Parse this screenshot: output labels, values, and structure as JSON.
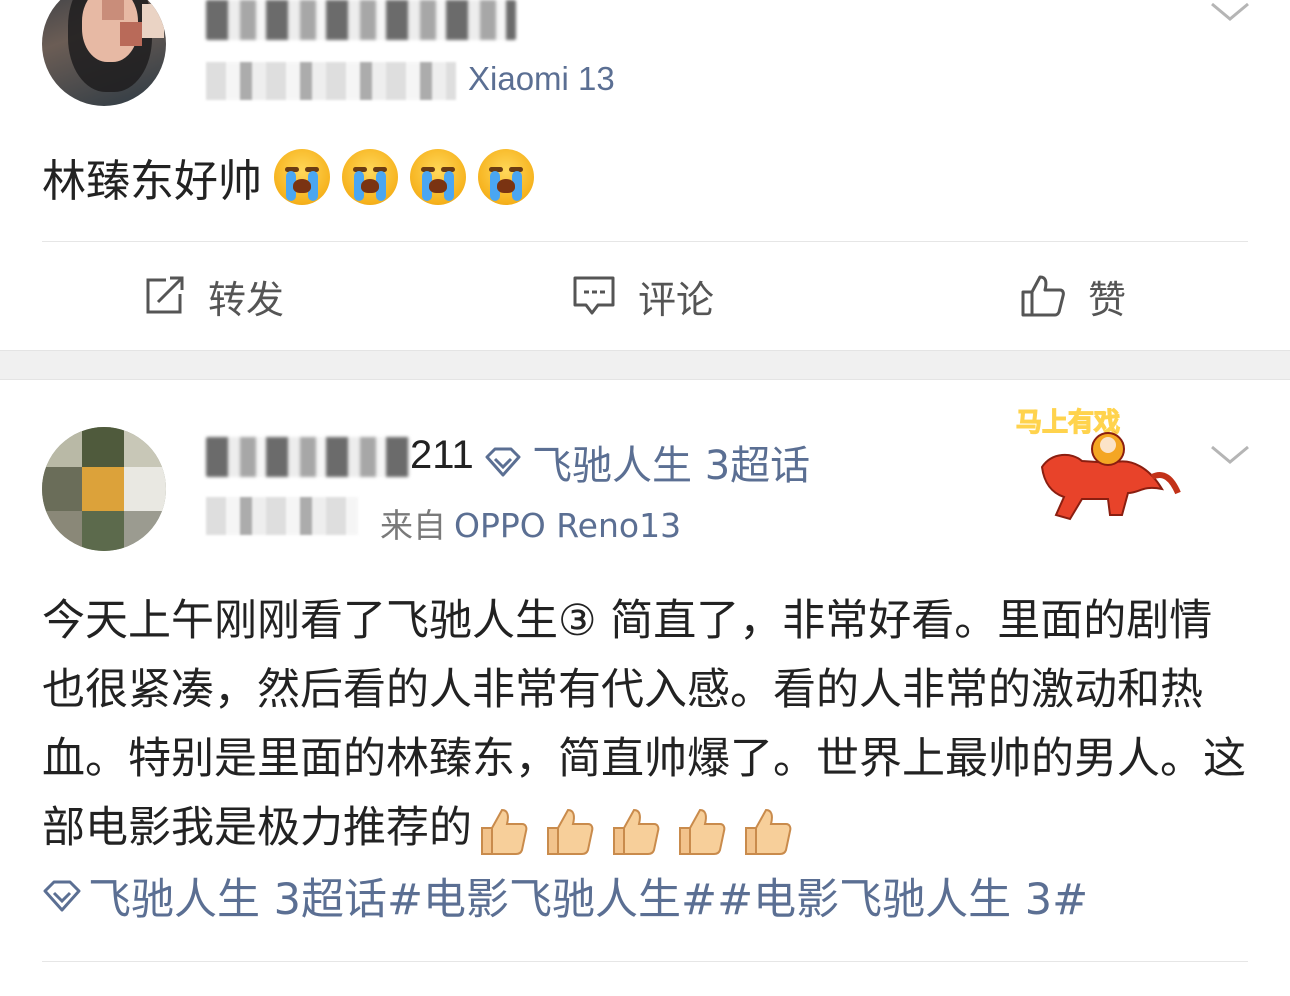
{
  "post1": {
    "author_name": "",
    "source_text": "Xiaomi 13",
    "content_text": "林臻东好帅",
    "emojis": [
      "crying-face",
      "crying-face",
      "crying-face",
      "crying-face"
    ],
    "actions": {
      "repost_label": "转发",
      "comment_label": "评论",
      "like_label": "赞"
    }
  },
  "post2": {
    "author_name_suffix": "211",
    "topic_label": "飞驰人生 3超话",
    "time_text": "",
    "source_prefix": "来自",
    "source_device": "OPPO Reno13",
    "sticker_text": "马上有戏",
    "content_text": "今天上午刚刚看了飞驰人生③ 简直了，非常好看。里面的剧情也很紧凑，然后看的人非常有代入感。看的人非常的激动和热血。特别是里面的林臻东，简直帅爆了。世界上最帅的男人。这部电影我是极力推荐的",
    "thumbs_count": 5,
    "tags_text": "飞驰人生 3超话#电影飞驰人生##电影飞驰人生 3#"
  },
  "colors": {
    "link_blue": "#5b6f93",
    "text_main": "#222222",
    "text_meta": "#7a7a7a",
    "separator": "#f0f0f0"
  }
}
